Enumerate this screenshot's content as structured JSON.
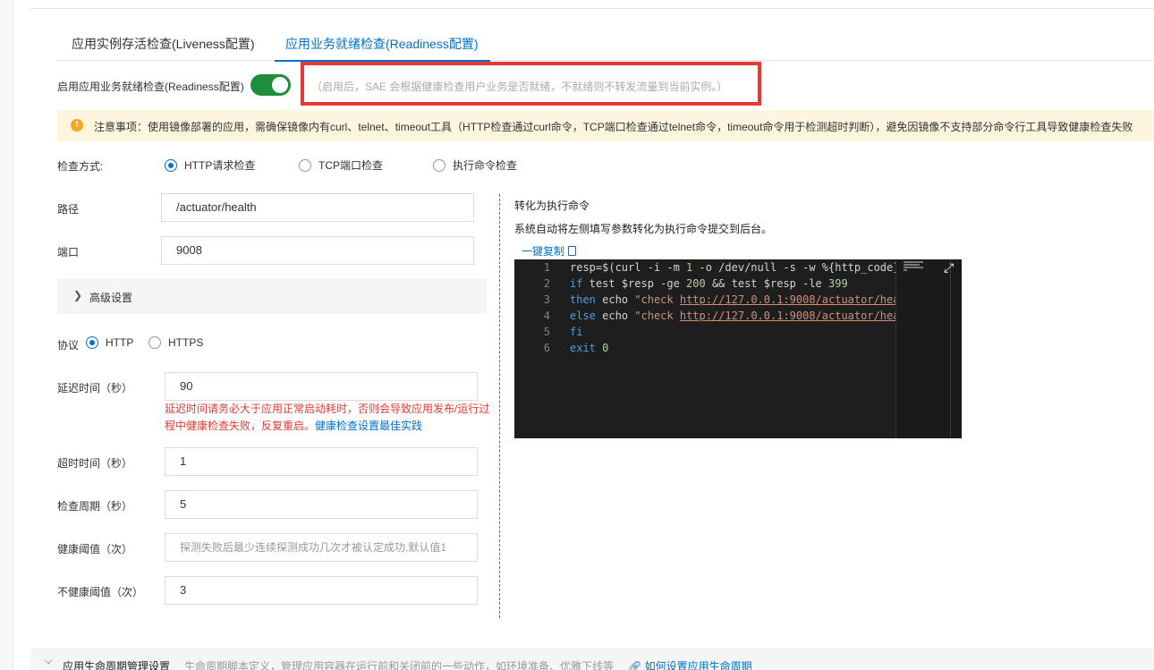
{
  "tabs": [
    {
      "label": "应用实例存活检查(Liveness配置)"
    },
    {
      "label": "应用业务就绪检查(Readiness配置)",
      "active": true
    }
  ],
  "enable": {
    "label": "启用应用业务就绪检查(Readiness配置)",
    "on": true,
    "hint": "（启用后，SAE 会根据健康检查用户业务是否就绪，不就绪则不转发流量到当前实例。）"
  },
  "notice": {
    "text": "注意事项：使用镜像部署的应用，需确保镜像内有curl、telnet、timeout工具（HTTP检查通过curl命令，TCP端口检查通过telnet命令，timeout命令用于检测超时判断），避免因镜像不支持部分命令行工具导致健康检查失败"
  },
  "check_method": {
    "label": "检查方式:",
    "options": [
      "HTTP请求检查",
      "TCP端口检查",
      "执行命令检查"
    ],
    "selected": "HTTP请求检查"
  },
  "path": {
    "label": "路径",
    "value": "/actuator/health"
  },
  "port": {
    "label": "端口",
    "value": "9008"
  },
  "advanced": {
    "label": "高级设置"
  },
  "protocol": {
    "label": "协议",
    "options": [
      "HTTP",
      "HTTPS"
    ],
    "selected": "HTTP"
  },
  "delay": {
    "label": "延迟时间（秒）",
    "value": "90",
    "warning": "延迟时间请务必大于应用正常启动耗时，否则会导致应用发布/运行过程中健康检查失败，反复重启。",
    "link": "健康检查设置最佳实践"
  },
  "timeout": {
    "label": "超时时间（秒）",
    "value": "1"
  },
  "period": {
    "label": "检查周期（秒）",
    "value": "5"
  },
  "healthy_threshold": {
    "label": "健康阈值（次）",
    "placeholder": "探测失败后最少连续探测成功几次才被认定成功,默认值1"
  },
  "unhealthy_threshold": {
    "label": "不健康阈值（次）",
    "value": "3"
  },
  "convert": {
    "title": "转化为执行命令",
    "desc": "系统自动将左侧填写参数转化为执行命令提交到后台。",
    "copy": "一键复制"
  },
  "editor": {
    "line_numbers": [
      "1",
      "2",
      "3",
      "4",
      "5",
      "6"
    ],
    "lines": [
      "resp=$(curl -i -m 1 -o /dev/null -s -w %{http_code}",
      "if test $resp -ge 200 && test $resp -le 399",
      "then echo \"check http://127.0.0.1:9008/actuator/hea",
      "else echo \"check http://127.0.0.1:9008/actuator/hea",
      "fi",
      "exit 0"
    ]
  },
  "lifecycle": {
    "title": "应用生命周期管理设置",
    "desc": "生命周期脚本定义，管理应用容器在运行前和关闭前的一些动作，如环境准备、优雅下线等",
    "link": "如何设置应用生命周期"
  }
}
